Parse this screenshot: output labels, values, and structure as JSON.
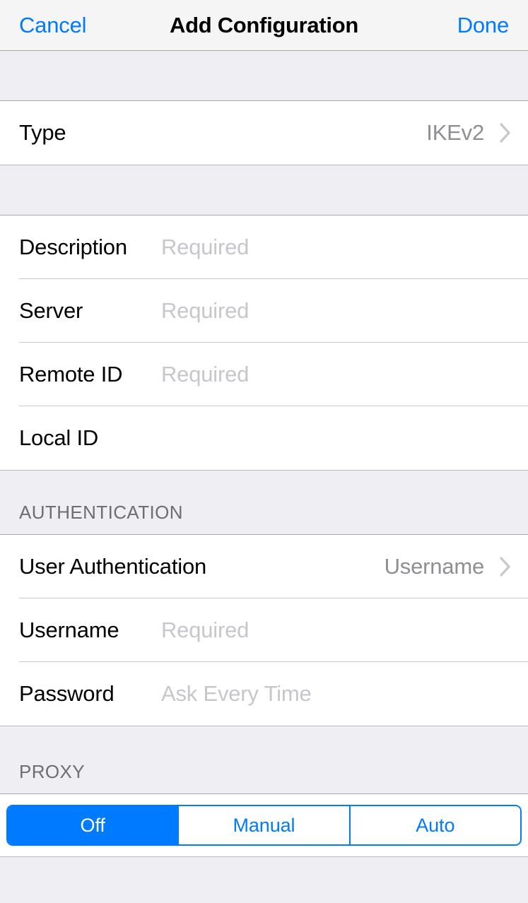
{
  "navbar": {
    "cancel_label": "Cancel",
    "title": "Add Configuration",
    "done_label": "Done"
  },
  "colors": {
    "accent_blue": "#007AFF",
    "group_background": "#EFEEF3",
    "row_background": "#FFFFFF",
    "separator": "#C8C7CC",
    "placeholder_text": "#C6C6CC",
    "detail_text": "#8E8E93",
    "header_text": "#6D6D72",
    "chevron": "#C7C7CC"
  },
  "sections": {
    "type": {
      "row": {
        "label": "Type",
        "value": "IKEv2",
        "accessory": "chevron-right-icon"
      }
    },
    "connection": {
      "rows": [
        {
          "label": "Description",
          "placeholder": "Required"
        },
        {
          "label": "Server",
          "placeholder": "Required"
        },
        {
          "label": "Remote ID",
          "placeholder": "Required"
        },
        {
          "label": "Local ID",
          "placeholder": ""
        }
      ]
    },
    "authentication": {
      "header": "AUTHENTICATION",
      "rows": [
        {
          "label": "User Authentication",
          "value": "Username",
          "accessory": "chevron-right-icon"
        },
        {
          "label": "Username",
          "placeholder": "Required"
        },
        {
          "label": "Password",
          "placeholder": "Ask Every Time"
        }
      ]
    },
    "proxy": {
      "header": "PROXY",
      "segments": [
        {
          "label": "Off",
          "selected": true
        },
        {
          "label": "Manual",
          "selected": false
        },
        {
          "label": "Auto",
          "selected": false
        }
      ]
    }
  }
}
